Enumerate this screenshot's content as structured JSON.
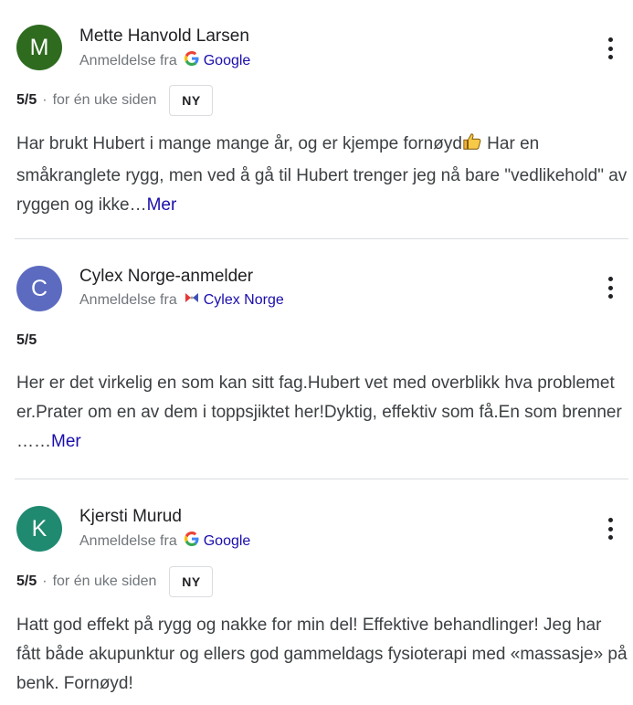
{
  "reviews": [
    {
      "avatar_letter": "M",
      "avatar_color": "#2e6b1f",
      "name": "Mette Hanvold Larsen",
      "source_prefix": "Anmeldelse fra",
      "source_name": "Google",
      "source_icon": "google-icon",
      "rating": "5/5",
      "separator": "·",
      "time": "for én uke siden",
      "badge": "NY",
      "text_part1": "Har brukt Hubert i mange mange år, og er kjempe fornøyd",
      "emoji": "thumbs-up-icon",
      "text_part2": " Har en småkranglete rygg, men ved å gå til Hubert trenger jeg nå bare \"vedlikehold\" av ryggen og ikke…",
      "more_label": "Mer"
    },
    {
      "avatar_letter": "C",
      "avatar_color": "#5c6bc0",
      "name": "Cylex Norge-anmelder",
      "source_prefix": "Anmeldelse fra",
      "source_name": "Cylex Norge",
      "source_icon": "cylex-icon",
      "rating": "5/5",
      "text": "Her er det virkelig en som kan sitt fag.Hubert vet med overblikk hva problemet er.Prater om en av dem i toppsjiktet her!Dyktig, effektiv som få.En som brenner ……",
      "more_label": "Mer"
    },
    {
      "avatar_letter": "K",
      "avatar_color": "#1f8a70",
      "name": "Kjersti Murud",
      "source_prefix": "Anmeldelse fra",
      "source_name": "Google",
      "source_icon": "google-icon",
      "rating": "5/5",
      "separator": "·",
      "time": "for én uke siden",
      "badge": "NY",
      "text": "Hatt god effekt på rygg og nakke for min del! Effektive behandlinger! Jeg har fått både akupunktur og ellers god gammeldags fysioterapi med «massasje» på benk. Fornøyd!"
    }
  ]
}
